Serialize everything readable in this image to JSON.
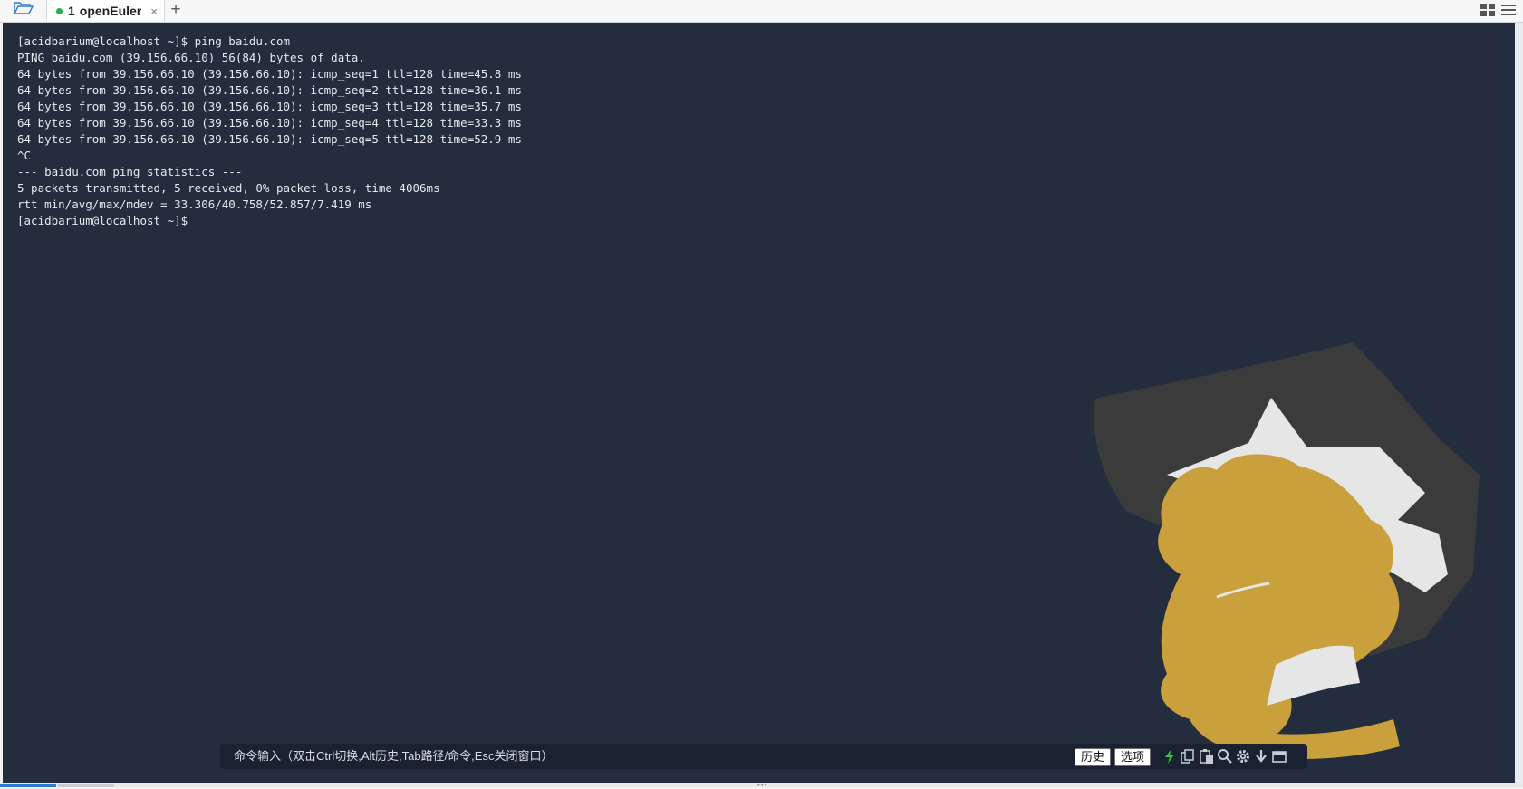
{
  "tabbar": {
    "folder_icon": "folder-open-icon",
    "tab": {
      "number": "1",
      "title": "openEuler",
      "status_color": "#22b14c",
      "close_glyph": "×"
    },
    "add_glyph": "+",
    "layout_icon": "grid-layout-icon",
    "menu_icon": "hamburger-menu-icon"
  },
  "terminal": {
    "background": "#232d3e",
    "lines": [
      "[acidbarium@localhost ~]$ ping baidu.com",
      "PING baidu.com (39.156.66.10) 56(84) bytes of data.",
      "64 bytes from 39.156.66.10 (39.156.66.10): icmp_seq=1 ttl=128 time=45.8 ms",
      "64 bytes from 39.156.66.10 (39.156.66.10): icmp_seq=2 ttl=128 time=36.1 ms",
      "64 bytes from 39.156.66.10 (39.156.66.10): icmp_seq=3 ttl=128 time=35.7 ms",
      "64 bytes from 39.156.66.10 (39.156.66.10): icmp_seq=4 ttl=128 time=33.3 ms",
      "64 bytes from 39.156.66.10 (39.156.66.10): icmp_seq=5 ttl=128 time=52.9 ms",
      "^C",
      "--- baidu.com ping statistics ---",
      "5 packets transmitted, 5 received, 0% packet loss, time 4006ms",
      "rtt min/avg/max/mdev = 33.306/40.758/52.857/7.419 ms",
      "[acidbarium@localhost ~]$"
    ]
  },
  "command_bar": {
    "hint": "命令输入（双击Ctrl切换,Alt历史,Tab路径/命令,Esc关闭窗口）",
    "history_label": "历史",
    "options_label": "选项",
    "tools": [
      "lightning-icon",
      "copy-icon",
      "paste-icon",
      "search-icon",
      "gear-icon",
      "download-icon",
      "window-icon"
    ]
  }
}
